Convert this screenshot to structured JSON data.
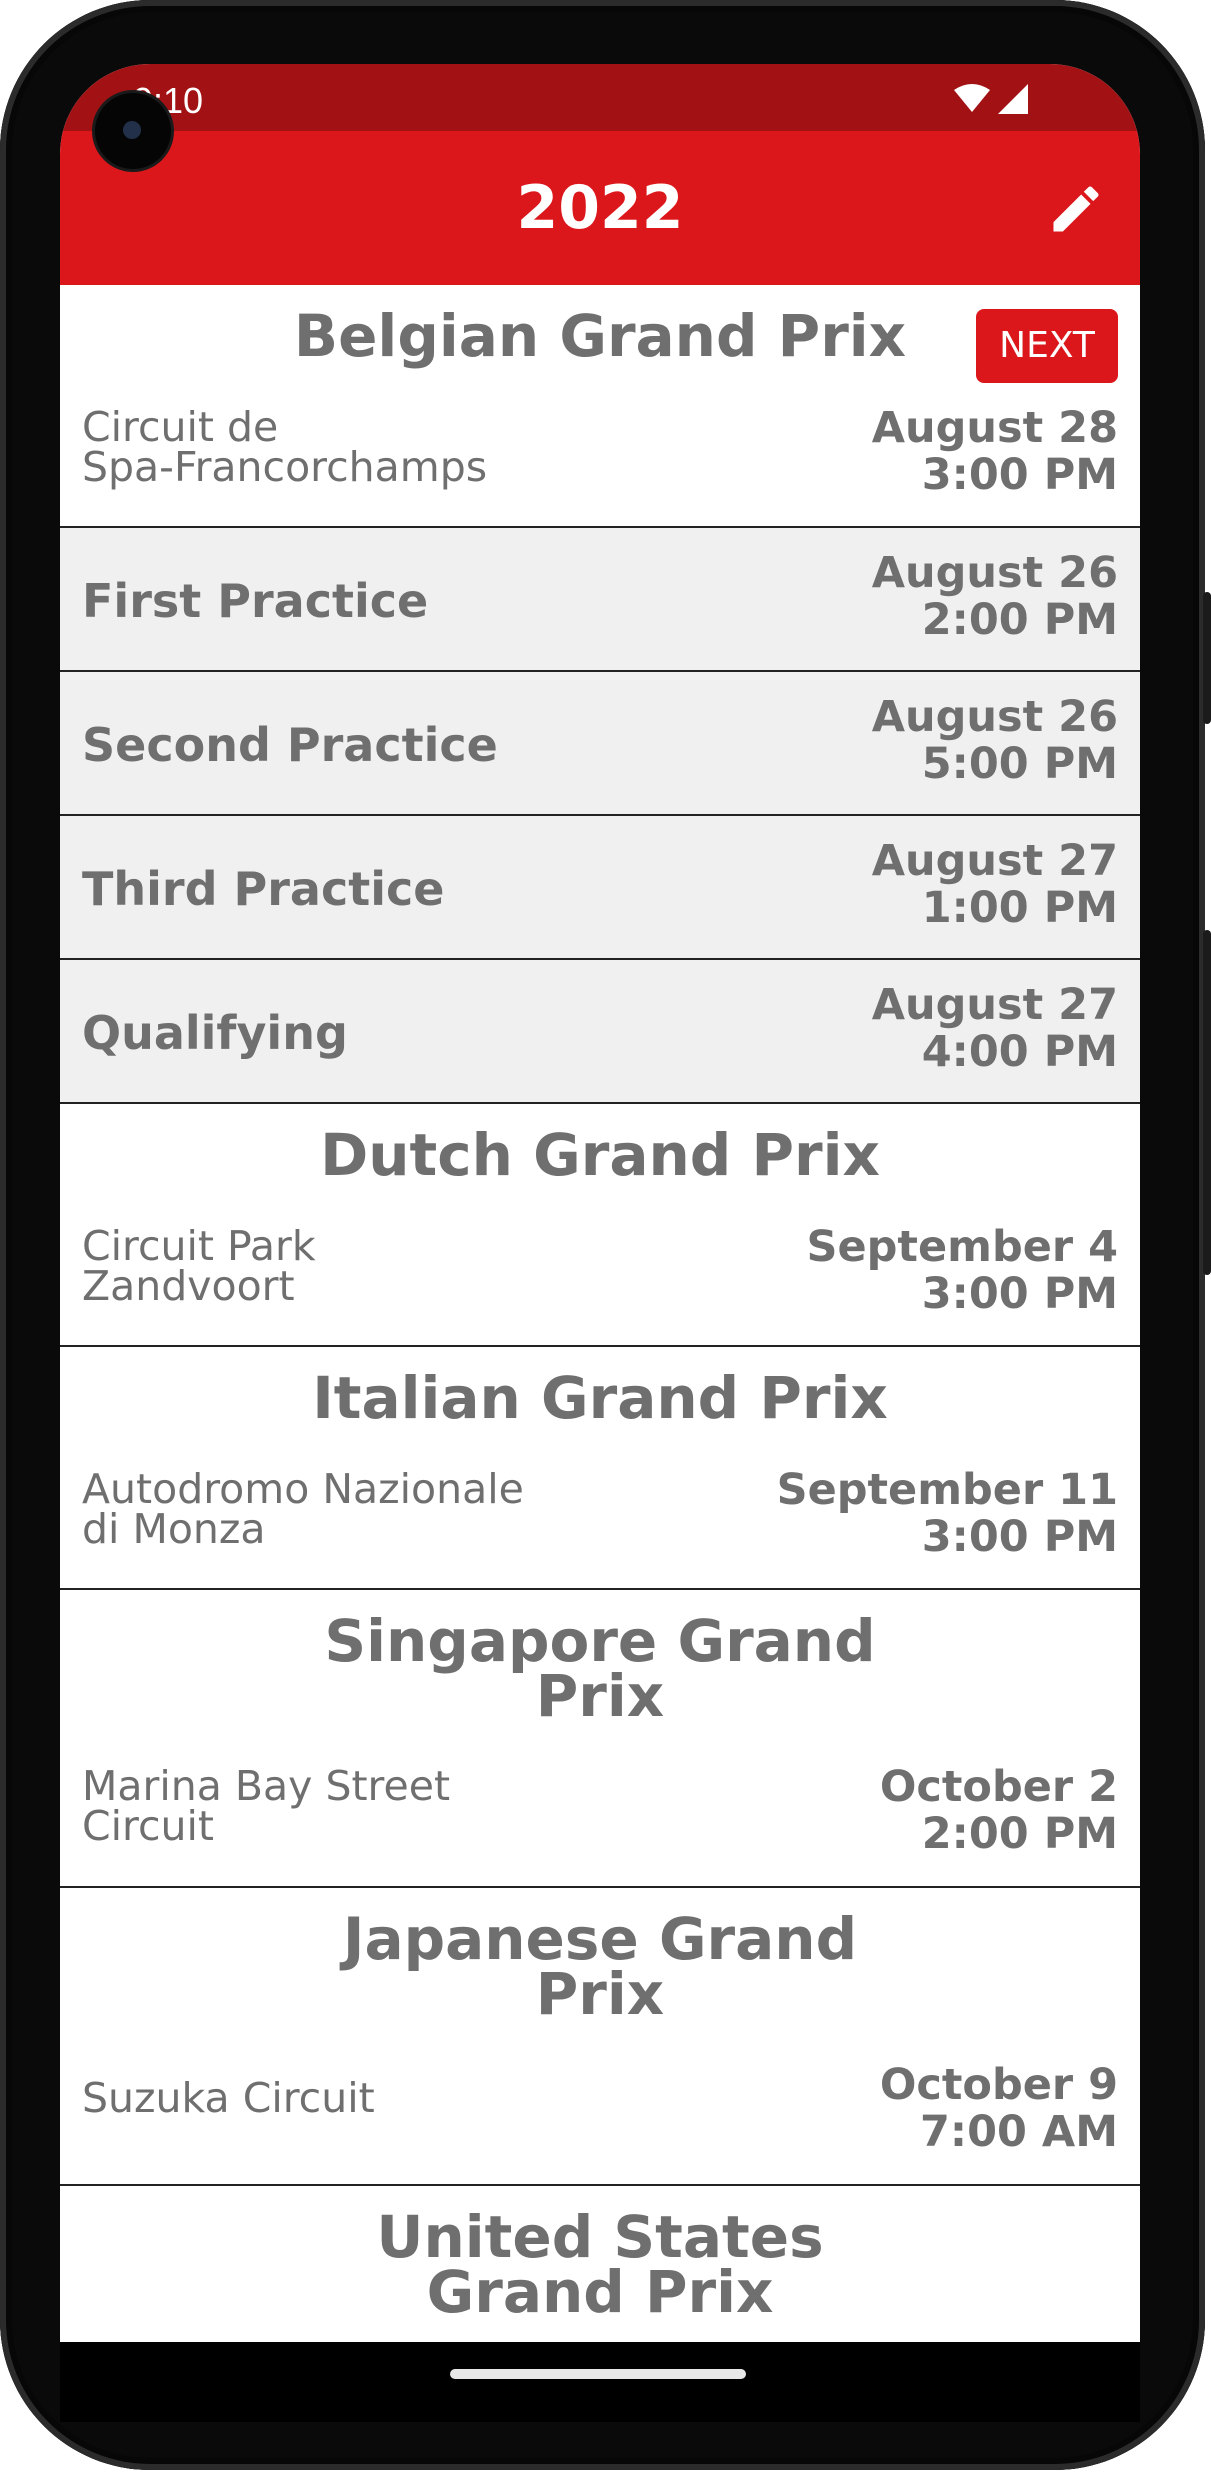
{
  "status_bar": {
    "time": "9:10"
  },
  "app_bar": {
    "title": "2022"
  },
  "races": [
    {
      "name": "Belgian Grand Prix",
      "badge": "NEXT",
      "circuit": "Circuit de\nSpa-Francorchamps",
      "date": "August 28",
      "time": "3:00 PM",
      "sessions": [
        {
          "name": "First Practice",
          "date": "August 26",
          "time": "2:00 PM"
        },
        {
          "name": "Second Practice",
          "date": "August 26",
          "time": "5:00 PM"
        },
        {
          "name": "Third Practice",
          "date": "August 27",
          "time": "1:00 PM"
        },
        {
          "name": "Qualifying",
          "date": "August 27",
          "time": "4:00 PM"
        }
      ]
    },
    {
      "name": "Dutch Grand Prix",
      "circuit": "Circuit Park\nZandvoort",
      "date": "September 4",
      "time": "3:00 PM"
    },
    {
      "name": "Italian Grand Prix",
      "circuit": "Autodromo Nazionale\ndi Monza",
      "date": "September 11",
      "time": "3:00 PM"
    },
    {
      "name": "Singapore Grand\nPrix",
      "circuit": "Marina Bay Street\nCircuit",
      "date": "October 2",
      "time": "2:00 PM"
    },
    {
      "name": "Japanese Grand\nPrix",
      "circuit": "Suzuka Circuit",
      "date": "October 9",
      "time": "7:00 AM"
    },
    {
      "name": "United States\nGrand Prix"
    }
  ],
  "colors": {
    "accent": "#dc171b",
    "status_bar": "#a21215",
    "text": "#6f6f6f",
    "session_bg": "#f0f0f0"
  },
  "icons": {
    "edit": "pencil-icon",
    "wifi": "wifi-icon",
    "signal": "signal-icon"
  }
}
